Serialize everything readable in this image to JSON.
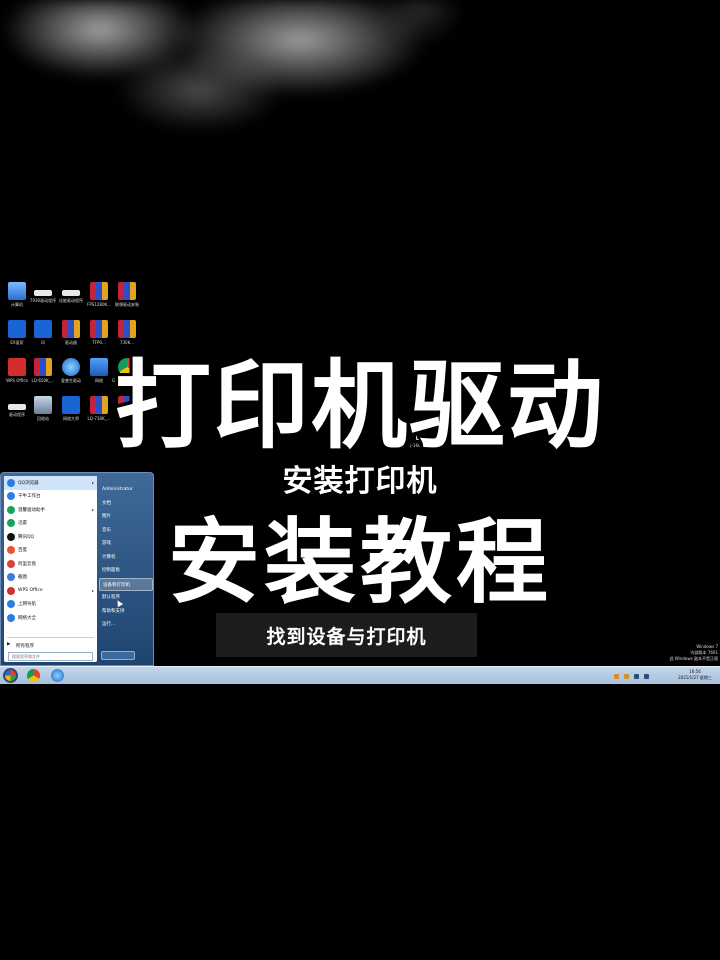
{
  "overlay": {
    "title_line1": "打印机驱动",
    "title_line2": "安装教程",
    "subtitle": "安装打印机",
    "caption": "找到设备与打印机"
  },
  "desktop": {
    "icons": [
      {
        "label": "计算机",
        "icon": "computer-icon"
      },
      {
        "label": "7930驱动程序",
        "icon": "document-icon"
      },
      {
        "label": "佳能驱动程序",
        "icon": "document-icon"
      },
      {
        "label": "FPS1280K...",
        "icon": "archive-icon"
      },
      {
        "label": "联想驱动安装",
        "icon": "archive-icon"
      },
      {
        "label": "EX爱家",
        "icon": "app-icon"
      },
      {
        "label": "印",
        "icon": "app-icon"
      },
      {
        "label": "驱动器",
        "icon": "archive-icon"
      },
      {
        "label": "TFP0...",
        "icon": "archive-icon"
      },
      {
        "label": "730K...",
        "icon": "archive-icon"
      },
      {
        "label": "WPS Office",
        "icon": "wps-icon"
      },
      {
        "label": "LQ-650K_...",
        "icon": "archive-icon"
      },
      {
        "label": "爱普生驱动",
        "icon": "globe-icon"
      },
      {
        "label": "网络",
        "icon": "network-icon"
      },
      {
        "label": "Google Chrome",
        "icon": "chrome-icon"
      },
      {
        "label": "驱动程序",
        "icon": "document-icon"
      },
      {
        "label": "回收站",
        "icon": "recycle-bin-icon"
      },
      {
        "label": "网络大师",
        "icon": "app-icon"
      },
      {
        "label": "LQ-730K_...",
        "icon": "archive-icon"
      },
      {
        "label": "打印机厂商",
        "icon": "archive-icon"
      }
    ],
    "printer_label": "LQ-1600K..."
  },
  "start_menu": {
    "left_items": [
      {
        "label": "QQ浏览器",
        "has_arrow": true,
        "color": "#2a7de1"
      },
      {
        "label": "千牛工作台",
        "has_arrow": false,
        "color": "#2a7de1"
      },
      {
        "label": "温馨驱动助手",
        "has_arrow": true,
        "color": "#1aa35a"
      },
      {
        "label": "迅雷",
        "has_arrow": false,
        "color": "#1aa35a"
      },
      {
        "label": "腾讯QQ",
        "has_arrow": false,
        "color": "#111111"
      },
      {
        "label": "百度",
        "has_arrow": false,
        "color": "#e8552f"
      },
      {
        "label": "阿里云盘",
        "has_arrow": false,
        "color": "#e23b3b"
      },
      {
        "label": "截图",
        "has_arrow": false,
        "color": "#3b7ed6"
      },
      {
        "label": "WPS Office",
        "has_arrow": true,
        "color": "#d32d2d"
      },
      {
        "label": "上网导航",
        "has_arrow": false,
        "color": "#2a7de1"
      },
      {
        "label": "网络大全",
        "has_arrow": false,
        "color": "#2a7de1"
      }
    ],
    "all_programs": "所有程序",
    "search_placeholder": "搜索程序和文件",
    "right_items": [
      {
        "label": "Administrator",
        "highlight": false
      },
      {
        "label": "文档",
        "highlight": false
      },
      {
        "label": "图片",
        "highlight": false
      },
      {
        "label": "音乐",
        "highlight": false
      },
      {
        "label": "游戏",
        "highlight": false
      },
      {
        "label": "计算机",
        "highlight": false
      },
      {
        "label": "控制面板",
        "highlight": false
      },
      {
        "label": "设备和打印机",
        "highlight": true
      },
      {
        "label": "默认程序",
        "highlight": false
      },
      {
        "label": "帮助和支持",
        "highlight": false
      },
      {
        "label": "运行...",
        "highlight": false
      }
    ]
  },
  "taskbar": {
    "clock_time": "16:56",
    "clock_date": "2021/1/27 星期三"
  },
  "watermark": {
    "line1": "Windows 7",
    "line2": "内部版本 7601",
    "line3": "此 Windows 副本不是正版"
  }
}
